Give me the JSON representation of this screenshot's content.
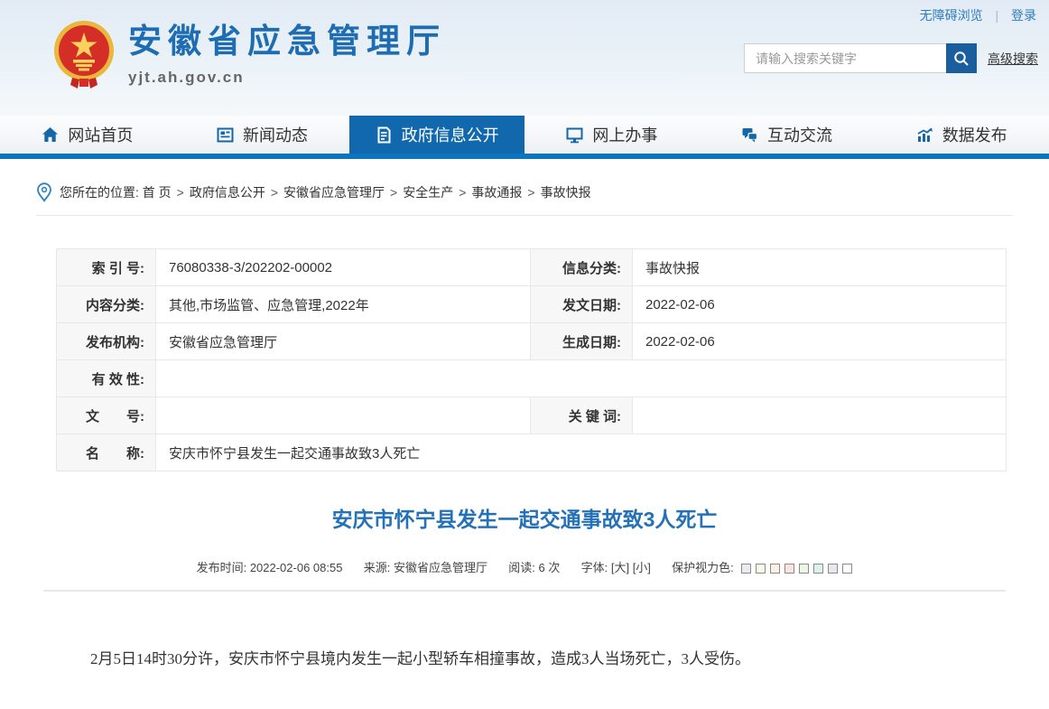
{
  "colors": {
    "brand_blue": "#1e6db3",
    "nav_active_bg": "#1168ac",
    "nav_strip": "#0d74be",
    "search_button": "#1b5e9e",
    "title_blue": "#2471b8"
  },
  "top_bar": {
    "accessibility_label": "无障碍浏览",
    "separator": "|",
    "login_label": "登录"
  },
  "header": {
    "site_name": "安徽省应急管理厅",
    "site_url": "yjt.ah.gov.cn",
    "search_placeholder": "请输入搜索关键字",
    "advanced_search_label": "高级搜索"
  },
  "nav": {
    "items": [
      {
        "label": "网站首页",
        "icon": "home-icon",
        "active": false
      },
      {
        "label": "新闻动态",
        "icon": "news-icon",
        "active": false
      },
      {
        "label": "政府信息公开",
        "icon": "document-icon",
        "active": true
      },
      {
        "label": "网上办事",
        "icon": "monitor-icon",
        "active": false
      },
      {
        "label": "互动交流",
        "icon": "chat-icon",
        "active": false
      },
      {
        "label": "数据发布",
        "icon": "chart-icon",
        "active": false
      }
    ]
  },
  "breadcrumb": {
    "prefix": "您所在的位置:",
    "separator": ">",
    "items": [
      "首 页",
      "政府信息公开",
      "安徽省应急管理厅",
      "安全生产",
      "事故通报",
      "事故快报"
    ]
  },
  "info_table": {
    "rows": [
      {
        "label1": "索 引 号:",
        "value1": "76080338-3/202202-00002",
        "label2": "信息分类:",
        "value2": "事故快报"
      },
      {
        "label1": "内容分类:",
        "value1": "其他,市场监管、应急管理,2022年",
        "label2": "发文日期:",
        "value2": "2022-02-06"
      },
      {
        "label1": "发布机构:",
        "value1": "安徽省应急管理厅",
        "label2": "生成日期:",
        "value2": "2022-02-06"
      },
      {
        "label1": "有 效 性:",
        "value1": ""
      },
      {
        "label1": "文　　号:",
        "value1": "",
        "label2": "关 键 词:",
        "value2": ""
      },
      {
        "label1": "名　　称:",
        "value1": "安庆市怀宁县发生一起交通事故致3人死亡"
      }
    ]
  },
  "article": {
    "title": "安庆市怀宁县发生一起交通事故致3人死亡",
    "meta": {
      "publish_label": "发布时间:",
      "publish_time": "2022-02-06 08:55",
      "source_label": "来源:",
      "source": "安徽省应急管理厅",
      "views_label": "阅读:",
      "views": "6 次",
      "font_label": "字体:",
      "font_large": "[大]",
      "font_small": "[小]",
      "eye_protect_label": "保护视力色:",
      "eye_protect_colors": [
        "#eaebf1",
        "#f6f9e6",
        "#fdf0e2",
        "#fae3e3",
        "#ecf8e0",
        "#dcf2ec",
        "#e8e8ec",
        "#ffffff"
      ]
    },
    "body": "2月5日14时30分许，安庆市怀宁县境内发生一起小型轿车相撞事故，造成3人当场死亡，3人受伤。"
  }
}
